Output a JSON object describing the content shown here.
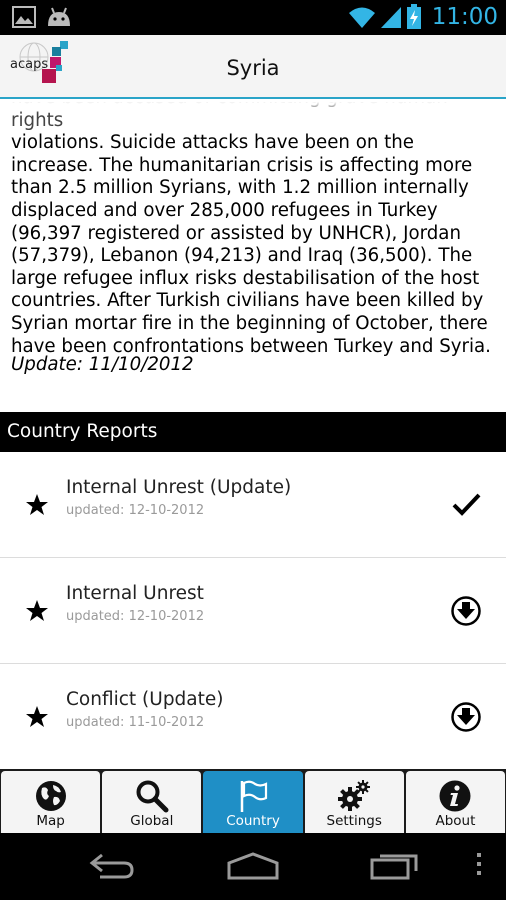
{
  "status_bar": {
    "time": "11:00",
    "icons": [
      "image-icon",
      "android-icon",
      "wifi-icon",
      "signal-icon",
      "battery-charging-icon"
    ]
  },
  "header": {
    "logo_text": "acaps",
    "title": "Syria"
  },
  "summary": {
    "clipped_line": "have been accused of committing grave human rights",
    "text": "violations. Suicide attacks have been on the increase. The humanitarian crisis is affecting more than 2.5 million Syrians, with 1.2 million internally displaced and over 285,000 refugees in Turkey (96,397 registered or assisted by UNHCR), Jordan (57,379), Lebanon (94,213) and Iraq (36,500). The large refugee influx risks destabilisation of the host countries. After Turkish civilians have been killed by Syrian mortar fire in the beginning of October, there have been confrontations between Turkey and Syria.",
    "update": "Update: 11/10/2012"
  },
  "section": {
    "title": "Country Reports"
  },
  "reports": [
    {
      "title": "Internal Unrest (Update)",
      "date": "updated: 12-10-2012",
      "action_icon": "checkmark-icon"
    },
    {
      "title": "Internal Unrest",
      "date": "updated: 12-10-2012",
      "action_icon": "download-icon"
    },
    {
      "title": "Conflict (Update)",
      "date": "updated: 11-10-2012",
      "action_icon": "download-icon"
    }
  ],
  "tabs": [
    {
      "label": "Map",
      "icon": "globe-icon",
      "active": false
    },
    {
      "label": "Global",
      "icon": "search-icon",
      "active": false
    },
    {
      "label": "Country",
      "icon": "flag-icon",
      "active": true
    },
    {
      "label": "Settings",
      "icon": "gears-icon",
      "active": false
    },
    {
      "label": "About",
      "icon": "info-icon",
      "active": false
    }
  ],
  "colors": {
    "accent": "#1f8fc6",
    "header_rule": "#2aa4c8",
    "status_time": "#33b5e5"
  }
}
